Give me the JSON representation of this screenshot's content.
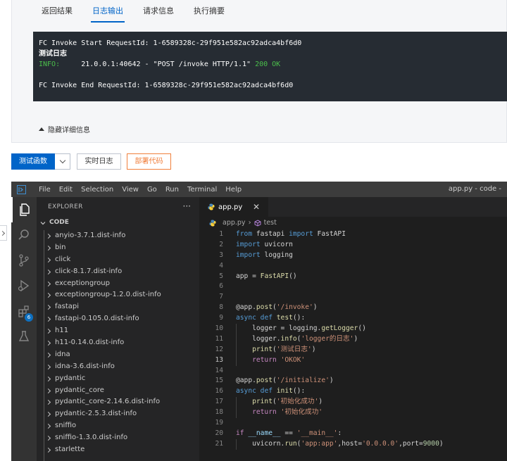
{
  "tabs": [
    "返回结果",
    "日志输出",
    "请求信息",
    "执行摘要"
  ],
  "active_tab": "日志输出",
  "log": {
    "start_line": "FC Invoke Start RequestId: 1-6589328c-29f951e582ac92adca4bf6d0",
    "user_line": "测试日志",
    "info_label": "INFO:",
    "info_addr": "21.0.0.1:40642 - \"POST /invoke HTTP/1.1\"",
    "info_status": "200 OK",
    "end_line": "FC Invoke End RequestId: 1-6589328c-29f951e582ac92adca4bf6d0"
  },
  "collapse_label": "隐藏详细信息",
  "buttons": {
    "test": "测试函数",
    "realtime_log": "实时日志",
    "deploy": "部署代码"
  },
  "colors": {
    "primary": "#0064c8",
    "deploy_accent": "#f07f3c",
    "terminal_bg": "#262c33",
    "vscode_bg": "#1e1e1e"
  },
  "vscode": {
    "menu": [
      "File",
      "Edit",
      "Selection",
      "View",
      "Go",
      "Run",
      "Terminal",
      "Help"
    ],
    "window_title": "app.py - code -",
    "explorer_label": "EXPLORER",
    "more_label": "···",
    "section_label": "CODE",
    "extensions_badge": "6",
    "files": [
      "anyio-3.7.1.dist-info",
      "bin",
      "click",
      "click-8.1.7.dist-info",
      "exceptiongroup",
      "exceptiongroup-1.2.0.dist-info",
      "fastapi",
      "fastapi-0.105.0.dist-info",
      "h11",
      "h11-0.14.0.dist-info",
      "idna",
      "idna-3.6.dist-info",
      "pydantic",
      "pydantic_core",
      "pydantic_core-2.14.6.dist-info",
      "pydantic-2.5.3.dist-info",
      "sniffio",
      "sniffio-1.3.0.dist-info",
      "starlette"
    ],
    "editor_tab": "app.py",
    "breadcrumb": [
      "app.py",
      "test"
    ],
    "current_line": 13,
    "code": [
      {
        "n": "1",
        "t": "from fastapi import FastAPI"
      },
      {
        "n": "2",
        "t": "import uvicorn"
      },
      {
        "n": "3",
        "t": "import logging"
      },
      {
        "n": "4",
        "t": ""
      },
      {
        "n": "5",
        "t": "app = FastAPI()"
      },
      {
        "n": "6",
        "t": ""
      },
      {
        "n": "7",
        "t": ""
      },
      {
        "n": "8",
        "t": "@app.post('/invoke')"
      },
      {
        "n": "9",
        "t": "async def test():"
      },
      {
        "n": "10",
        "t": "    logger = logging.getLogger()"
      },
      {
        "n": "11",
        "t": "    logger.info('logger的日志')"
      },
      {
        "n": "12",
        "t": "    print('测试日志')"
      },
      {
        "n": "13",
        "t": "    return 'OKOK'"
      },
      {
        "n": "14",
        "t": ""
      },
      {
        "n": "15",
        "t": "@app.post('/initialize')"
      },
      {
        "n": "16",
        "t": "async def init():"
      },
      {
        "n": "17",
        "t": "    print('初始化成功')"
      },
      {
        "n": "18",
        "t": "    return '初始化成功'"
      },
      {
        "n": "19",
        "t": ""
      },
      {
        "n": "20",
        "t": "if __name__ == '__main__':"
      },
      {
        "n": "21",
        "t": "    uvicorn.run('app:app',host='0.0.0.0',port=9000)"
      }
    ]
  }
}
